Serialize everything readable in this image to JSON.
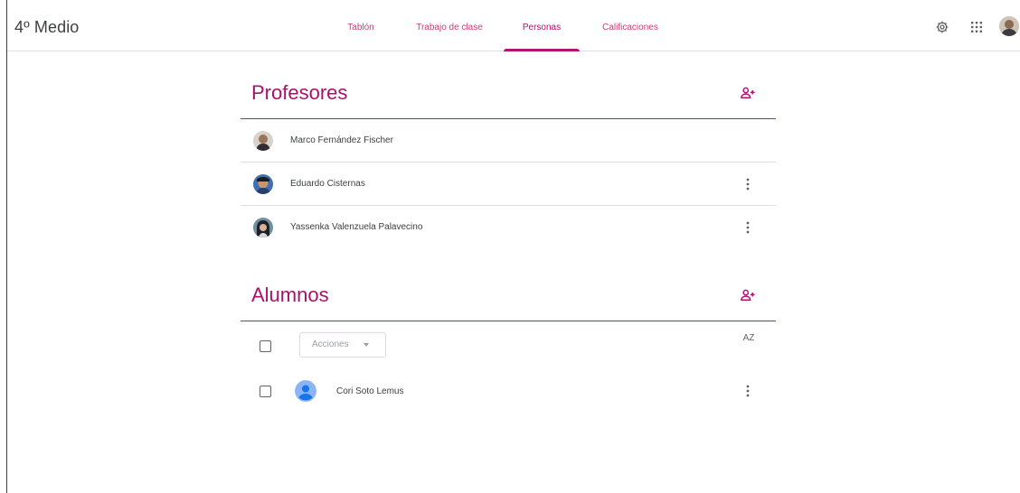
{
  "header": {
    "class_title": "4º Medio",
    "tabs": [
      {
        "label": "Tablón",
        "active": false
      },
      {
        "label": "Trabajo de clase",
        "active": false
      },
      {
        "label": "Personas",
        "active": true
      },
      {
        "label": "Calificaciones",
        "active": false
      }
    ],
    "icons": [
      "gear-icon",
      "apps-grid-icon",
      "avatar"
    ]
  },
  "teachers": {
    "title": "Profesores",
    "add_icon": "person-add-icon",
    "members": [
      {
        "name": "Marco Fernández Fischer",
        "has_menu": false
      },
      {
        "name": "Eduardo Cisternas",
        "has_menu": true
      },
      {
        "name": "Yassenka Valenzuela Palavecino",
        "has_menu": true
      }
    ]
  },
  "students": {
    "title": "Alumnos",
    "add_icon": "person-add-icon",
    "actions_label": "Acciones",
    "sort_icon": "sort-az-icon",
    "sort_label": "AZ",
    "members": [
      {
        "name": "Cori Soto Lemus",
        "has_menu": true
      }
    ]
  },
  "colors": {
    "accent": "#b3136f",
    "text": "#3c4043",
    "divider": "#e0e0e0"
  }
}
